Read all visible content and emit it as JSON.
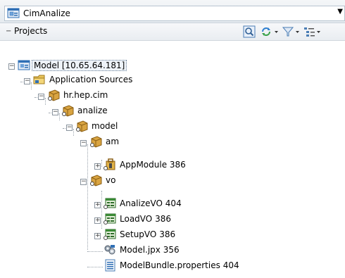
{
  "app_selector": {
    "value": "CimAnalize"
  },
  "panel": {
    "title": "Projects",
    "toolbar": [
      {
        "name": "search-icon"
      },
      {
        "name": "sync-icon"
      },
      {
        "name": "filter-icon"
      },
      {
        "name": "options-icon"
      }
    ]
  },
  "tree": [
    {
      "label": "Model [10.65.64.181]",
      "count": "",
      "icon": "project-icon",
      "toggle": "-",
      "selected": true
    },
    {
      "label": "Application Sources",
      "count": "",
      "icon": "folder-icon",
      "toggle": "-"
    },
    {
      "label": "hr.hep.cim",
      "count": "",
      "icon": "package-icon",
      "toggle": "-"
    },
    {
      "label": "analize",
      "count": "",
      "icon": "package-icon",
      "toggle": "-"
    },
    {
      "label": "model",
      "count": "",
      "icon": "package-icon",
      "toggle": "-"
    },
    {
      "label": "am",
      "count": "",
      "icon": "package-icon",
      "toggle": "-"
    },
    {
      "label": "AppModule",
      "count": "386",
      "icon": "app-module-icon",
      "toggle": "+"
    },
    {
      "label": "vo",
      "count": "",
      "icon": "package-icon",
      "toggle": "-"
    },
    {
      "label": "AnalizeVO",
      "count": "404",
      "icon": "view-object-icon",
      "toggle": "+"
    },
    {
      "label": "LoadVO",
      "count": "386",
      "icon": "view-object-icon",
      "toggle": "+"
    },
    {
      "label": "SetupVO",
      "count": "386",
      "icon": "view-object-icon",
      "toggle": "+"
    },
    {
      "label": "Model.jpx",
      "count": "356",
      "icon": "jpx-file-icon",
      "toggle": ""
    },
    {
      "label": "ModelBundle.properties",
      "count": "404",
      "icon": "properties-file-icon",
      "toggle": ""
    }
  ],
  "colors": {
    "accent": "#2f6fb5",
    "package": "#d9a441",
    "folder": "#e8c45a"
  }
}
